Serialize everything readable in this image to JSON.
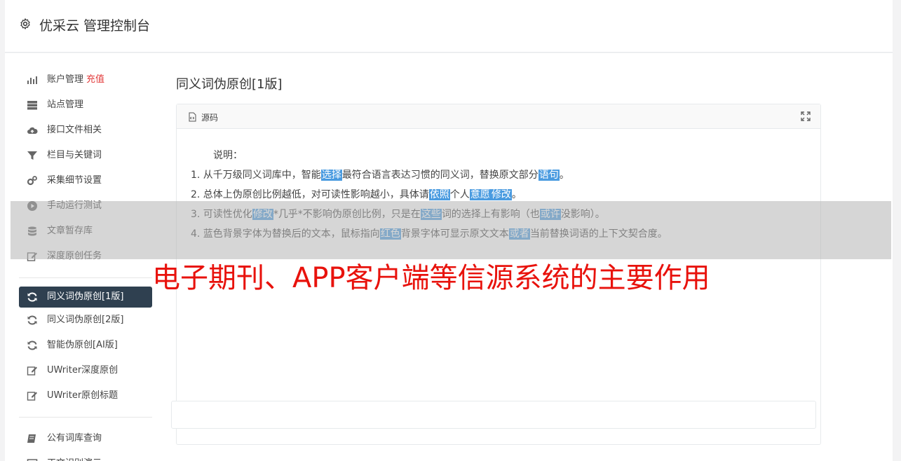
{
  "header": {
    "brand": "优采云 管理控制台"
  },
  "sidebar": {
    "group1": [
      {
        "label": "账户管理",
        "badge": "充值",
        "icon": "bar-chart-icon"
      },
      {
        "label": "站点管理",
        "icon": "server-icon"
      },
      {
        "label": "接口文件相关",
        "icon": "cloud-upload-icon"
      },
      {
        "label": "栏目与关键词",
        "icon": "filter-icon"
      },
      {
        "label": "采集细节设置",
        "icon": "gears-icon"
      },
      {
        "label": "手动运行测试",
        "icon": "play-circle-icon"
      },
      {
        "label": "文章暂存库",
        "icon": "database-icon"
      },
      {
        "label": "深度原创任务",
        "icon": "edit-icon"
      }
    ],
    "group2": [
      {
        "label": "同义词伪原创[1版]",
        "icon": "refresh-icon",
        "active": true
      },
      {
        "label": "同义词伪原创[2版]",
        "icon": "refresh-icon"
      },
      {
        "label": "智能伪原创[AI版]",
        "icon": "refresh-icon"
      },
      {
        "label": "UWriter深度原创",
        "icon": "edit-icon"
      },
      {
        "label": "UWriter原创标题",
        "icon": "edit-icon"
      }
    ],
    "group3": [
      {
        "label": "公有词库查询",
        "icon": "book-icon"
      },
      {
        "label": "正文识别演示",
        "icon": "square-icon"
      }
    ]
  },
  "content": {
    "title": "同义词伪原创[1版]",
    "panel_label": "源码",
    "intro": "说明：",
    "lines": [
      [
        "1. 从千万级同义词库中，智能",
        {
          "hl": "选择"
        },
        "最符合语言表达习惯的同义词，替换原文部分",
        {
          "hl": "语句"
        },
        "。"
      ],
      [
        "2. 总体上伪原创比例越低，对可读性影响越小，具体请",
        {
          "hl": "依照"
        },
        "个人",
        {
          "hl": "意愿"
        },
        {
          "hl": "修改"
        },
        "。"
      ],
      [
        "3. 可读性优化",
        {
          "hl": "修改"
        },
        "*几乎*不影响伪原创比例，只是在",
        {
          "hl": "这些"
        },
        "词的选择上有影响（也",
        {
          "hl": "或许"
        },
        "没影响）。"
      ],
      [
        "4. 蓝色背景字体为替换后的文本，鼠标指向",
        {
          "hl": "红色"
        },
        "背景字体可显示原文文本",
        {
          "hl": "或者"
        },
        "当前替换词语的上下文契合度。"
      ]
    ]
  },
  "overlay": {
    "text": "电子期刊、APP客户端等信源系统的主要作用"
  },
  "colors": {
    "highlight": "#4a9be0",
    "active_nav": "#2f4050",
    "overlay_text": "#e8120c",
    "badge": "#e23a3a"
  }
}
